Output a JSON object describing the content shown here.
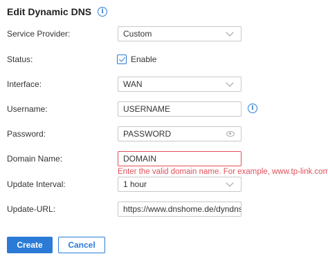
{
  "dialog": {
    "title": "Edit Dynamic DNS",
    "title_icon": "info-icon"
  },
  "form": {
    "service_provider": {
      "label": "Service Provider:",
      "value": "Custom"
    },
    "status": {
      "label": "Status:",
      "checkbox_label": "Enable",
      "checked": true
    },
    "interface": {
      "label": "Interface:",
      "value": "WAN"
    },
    "username": {
      "label": "Username:",
      "value": "USERNAME",
      "icon": "info-icon"
    },
    "password": {
      "label": "Password:",
      "value": "PASSWORD",
      "icon": "eye-icon"
    },
    "domain_name": {
      "label": "Domain Name:",
      "value": "DOMAIN",
      "error": "Enter the valid domain name. For example, www.tp-link.com."
    },
    "update_interval": {
      "label": "Update Interval:",
      "value": "1 hour"
    },
    "update_url": {
      "label": "Update-URL:",
      "value": "https://www.dnshome.de/dyndns.pl"
    }
  },
  "buttons": {
    "create": "Create",
    "cancel": "Cancel"
  },
  "colors": {
    "accent": "#2b7bd6",
    "error": "#e0505a"
  }
}
